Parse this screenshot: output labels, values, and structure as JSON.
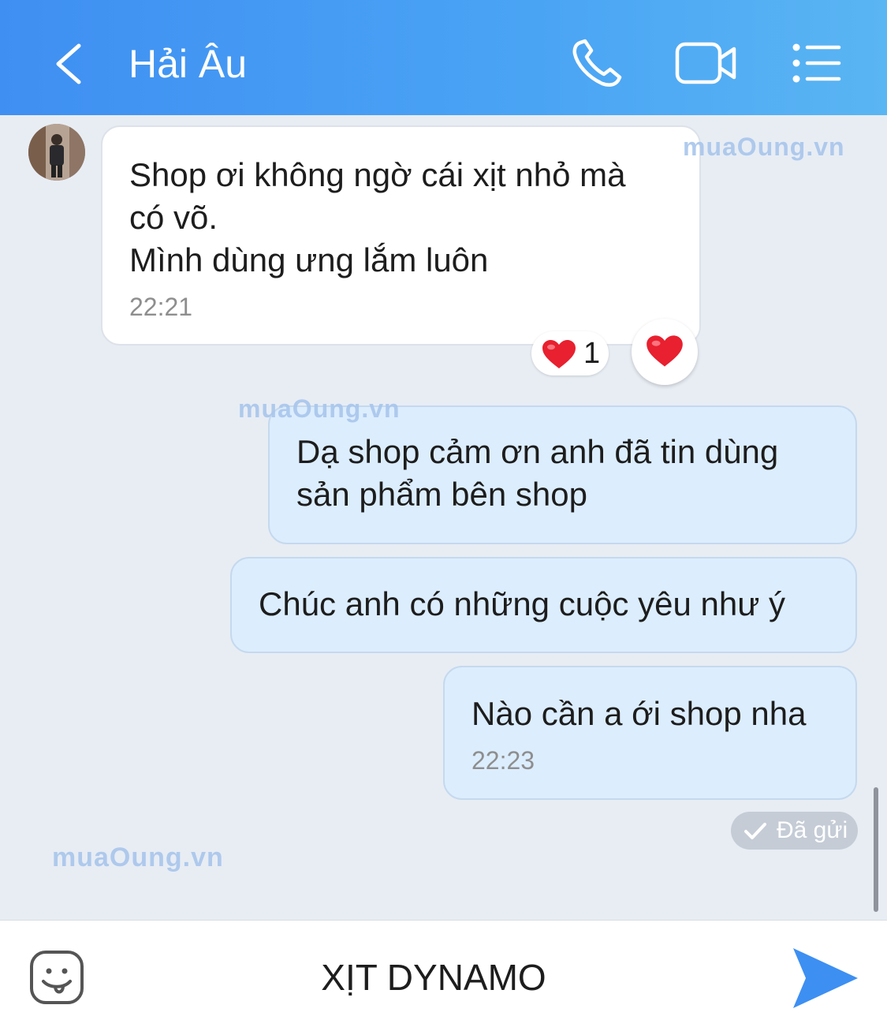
{
  "header": {
    "title": "Hải Âu"
  },
  "messages": [
    {
      "lines": [
        "Shop ơi không ngờ cái xịt nhỏ mà",
        "có võ.",
        "Mình dùng ưng lắm luôn"
      ],
      "time": "22:21"
    },
    {
      "lines": [
        "Dạ shop cảm ơn anh đã tin dùng",
        "sản phẩm bên shop"
      ]
    },
    {
      "lines": [
        "Chúc anh có những cuộc yêu như ý"
      ]
    },
    {
      "lines": [
        "Nào cần a ới shop nha"
      ],
      "time": "22:23"
    }
  ],
  "reaction": {
    "count": "1"
  },
  "status": {
    "sent_label": "Đã gửi"
  },
  "watermark": "muaOung.vn",
  "composer": {
    "value": "XỊT DYNAMO"
  },
  "colors": {
    "header_start": "#3f8ff2",
    "header_end": "#5ab5f3",
    "outgoing_bubble": "#dcedfe",
    "send_icon": "#3d8ff2",
    "heart": "#e8202f"
  }
}
